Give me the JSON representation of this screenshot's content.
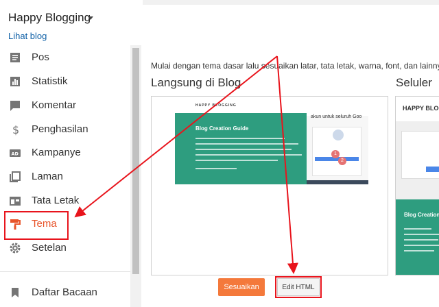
{
  "header": {
    "blog_name": "Happy Blogging",
    "view_blog": "Lihat blog"
  },
  "sidebar": {
    "items": [
      {
        "label": "Pos",
        "icon": "posts-icon"
      },
      {
        "label": "Statistik",
        "icon": "stats-icon"
      },
      {
        "label": "Komentar",
        "icon": "comments-icon"
      },
      {
        "label": "Penghasilan",
        "icon": "dollar-icon"
      },
      {
        "label": "Kampanye",
        "icon": "ad-icon"
      },
      {
        "label": "Laman",
        "icon": "pages-icon"
      },
      {
        "label": "Tata Letak",
        "icon": "layout-icon"
      },
      {
        "label": "Tema",
        "icon": "theme-paint-roller-icon",
        "active": true
      },
      {
        "label": "Setelan",
        "icon": "gear-icon"
      }
    ],
    "reading_list": {
      "label": "Daftar Bacaan",
      "icon": "bookmark-icon"
    }
  },
  "main": {
    "intro": "Mulai dengan tema dasar lalu sesuaikan latar, tata letak, warna, font, dan lainnya",
    "live_heading": "Langsung di Blog",
    "mobile_heading": "Seluler",
    "customize_label": "Sesuaikan",
    "edit_html_label": "Edit HTML"
  },
  "preview": {
    "site_title": "HAPPY BLOGGING",
    "post_title": "Blog Creation Guide",
    "popup_title": "akun untuk seluruh Goo",
    "badge_1": "1",
    "badge_2": "2",
    "mobile_title": "HAPPY BLOG",
    "mobile_post_title": "Blog Creation"
  },
  "colors": {
    "accent": "#f4793b",
    "active_nav": "#e8542a",
    "link": "#0d5fa6",
    "hero": "#2e9d7f",
    "annotation": "#e8141c"
  }
}
